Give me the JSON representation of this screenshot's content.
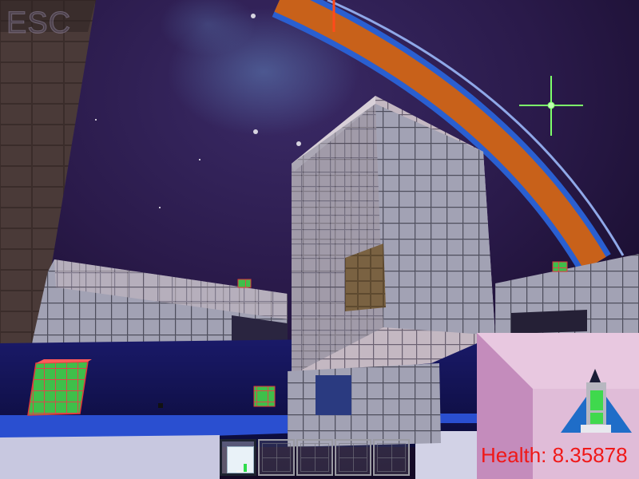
{
  "hud": {
    "menu_hint": "ESC",
    "health_label": "Health: 8.35878",
    "hotbar": {
      "slot_count": 5,
      "selected_slot": 1
    }
  },
  "icons": {
    "player_ship": "rocket-icon",
    "hotbar_item": "block-icon"
  },
  "colors": {
    "health_text": "#f01818",
    "space_sky": "#2a1a4a",
    "ring_orange": "#c8611a",
    "ring_blue": "#1f5fc6",
    "block_gray": "#8e8ea0",
    "floor_blue": "#2a4fd0",
    "minimap_bg": "#e8c8e0",
    "ship_green": "#3fd94d"
  }
}
